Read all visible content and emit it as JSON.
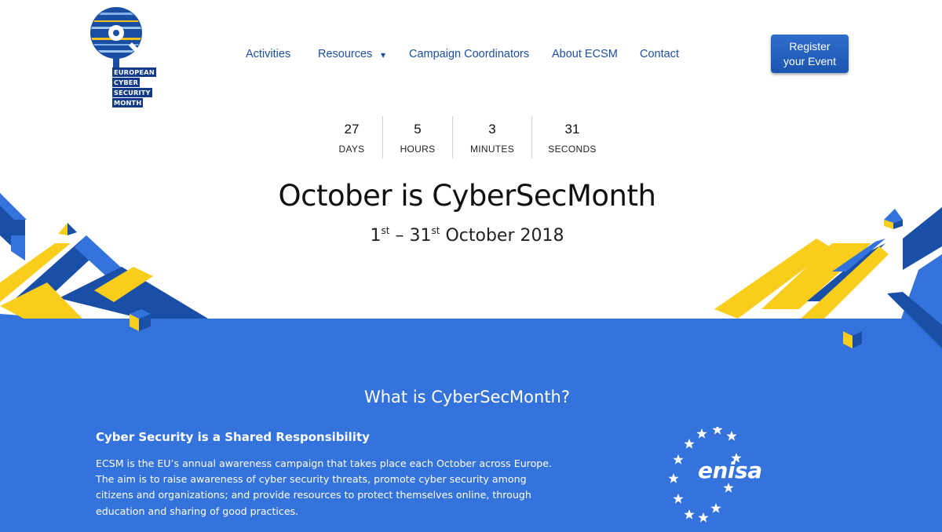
{
  "logo": {
    "words": [
      "EUROPEAN",
      "CYBER",
      "SECURITY",
      "MONTH"
    ]
  },
  "nav": {
    "items": [
      {
        "label": "Activities"
      },
      {
        "label": "Resources"
      },
      {
        "label": "Campaign Coordinators"
      },
      {
        "label": "About ECSM"
      },
      {
        "label": "Contact"
      }
    ],
    "resources_caret_icon": "caret-down-icon"
  },
  "register": {
    "line1": "Register",
    "line2": "your Event"
  },
  "countdown": {
    "days": {
      "value": "27",
      "label": "DAYS"
    },
    "hours": {
      "value": "5",
      "label": "HOURS"
    },
    "minutes": {
      "value": "3",
      "label": "MINUTES"
    },
    "seconds": {
      "value": "31",
      "label": "SECONDS"
    }
  },
  "hero": {
    "title": "October is CyberSecMonth",
    "date_start": "1",
    "date_start_sup": "st",
    "date_sep": " – ",
    "date_end": "31",
    "date_end_sup": "st",
    "date_tail": " October 2018"
  },
  "section": {
    "title": "What is CyberSecMonth?",
    "subheading": "Cyber Security is a Shared Responsibility",
    "body_lines": [
      "ECSM is the EU’s annual awareness campaign that takes place each October across Europe.",
      "The aim is to raise awareness of cyber security threats, promote cyber security among",
      "citizens and organizations; and provide resources to protect themselves online, through",
      "education and sharing of good practices."
    ]
  },
  "partner": {
    "name": "enisa"
  },
  "colors": {
    "brand_blue": "#3573dc",
    "dark_blue": "#1a4fa8",
    "yellow": "#f8cd1c",
    "nav_text": "#1c4fa3"
  }
}
